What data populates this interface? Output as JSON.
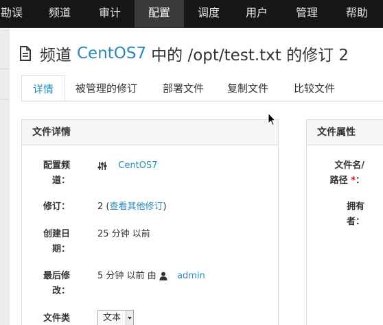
{
  "nav": {
    "items": [
      "勘误",
      "频道",
      "审计",
      "配置",
      "调度",
      "用户",
      "管理",
      "帮助"
    ],
    "active_index": 3
  },
  "page": {
    "title_prefix": "频道",
    "channel": "CentOS7",
    "title_mid": "中的 /opt/test.txt 的修订 2"
  },
  "tabs": [
    "详情",
    "被管理的修订",
    "部署文件",
    "复制文件",
    "比较文件"
  ],
  "details": {
    "heading": "文件详情",
    "channel_label": "配置频道：",
    "channel_label_line1": "配置频",
    "channel_label_line2": "道：",
    "channel_value": "CentOS7",
    "revision_label": "修订：",
    "revision_number": "2",
    "revision_link": "查看其他修订",
    "revision_open": "(",
    "revision_close": ")",
    "created_label_line1": "创建日",
    "created_label_line2": "期：",
    "created_value": "25 分钟 以前",
    "modified_label_line1": "最后修",
    "modified_label_line2": "改：",
    "modified_value": "5 分钟 以前 由",
    "modified_user": "admin",
    "filetype_label": "文件类",
    "filetype_value": "文本"
  },
  "properties": {
    "heading": "文件属性",
    "path_label_line1": "文件名/",
    "path_label_line2": "路径",
    "required_mark": "*",
    "path_label_colon": "：",
    "owner_label_line1": "拥有",
    "owner_label_line2": "者："
  },
  "colors": {
    "nav_bg": "#161616",
    "accent_link": "#2a8ab8",
    "required": "#d9001b"
  }
}
